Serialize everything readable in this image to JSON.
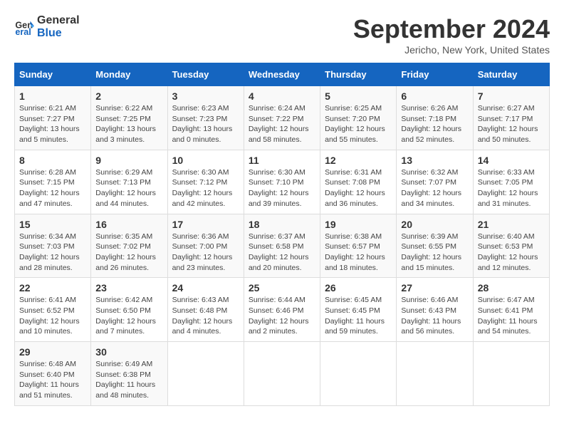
{
  "logo": {
    "line1": "General",
    "line2": "Blue"
  },
  "title": "September 2024",
  "location": "Jericho, New York, United States",
  "days_of_week": [
    "Sunday",
    "Monday",
    "Tuesday",
    "Wednesday",
    "Thursday",
    "Friday",
    "Saturday"
  ],
  "weeks": [
    [
      {
        "day": "1",
        "sunrise": "Sunrise: 6:21 AM",
        "sunset": "Sunset: 7:27 PM",
        "daylight": "Daylight: 13 hours and 5 minutes."
      },
      {
        "day": "2",
        "sunrise": "Sunrise: 6:22 AM",
        "sunset": "Sunset: 7:25 PM",
        "daylight": "Daylight: 13 hours and 3 minutes."
      },
      {
        "day": "3",
        "sunrise": "Sunrise: 6:23 AM",
        "sunset": "Sunset: 7:23 PM",
        "daylight": "Daylight: 13 hours and 0 minutes."
      },
      {
        "day": "4",
        "sunrise": "Sunrise: 6:24 AM",
        "sunset": "Sunset: 7:22 PM",
        "daylight": "Daylight: 12 hours and 58 minutes."
      },
      {
        "day": "5",
        "sunrise": "Sunrise: 6:25 AM",
        "sunset": "Sunset: 7:20 PM",
        "daylight": "Daylight: 12 hours and 55 minutes."
      },
      {
        "day": "6",
        "sunrise": "Sunrise: 6:26 AM",
        "sunset": "Sunset: 7:18 PM",
        "daylight": "Daylight: 12 hours and 52 minutes."
      },
      {
        "day": "7",
        "sunrise": "Sunrise: 6:27 AM",
        "sunset": "Sunset: 7:17 PM",
        "daylight": "Daylight: 12 hours and 50 minutes."
      }
    ],
    [
      {
        "day": "8",
        "sunrise": "Sunrise: 6:28 AM",
        "sunset": "Sunset: 7:15 PM",
        "daylight": "Daylight: 12 hours and 47 minutes."
      },
      {
        "day": "9",
        "sunrise": "Sunrise: 6:29 AM",
        "sunset": "Sunset: 7:13 PM",
        "daylight": "Daylight: 12 hours and 44 minutes."
      },
      {
        "day": "10",
        "sunrise": "Sunrise: 6:30 AM",
        "sunset": "Sunset: 7:12 PM",
        "daylight": "Daylight: 12 hours and 42 minutes."
      },
      {
        "day": "11",
        "sunrise": "Sunrise: 6:30 AM",
        "sunset": "Sunset: 7:10 PM",
        "daylight": "Daylight: 12 hours and 39 minutes."
      },
      {
        "day": "12",
        "sunrise": "Sunrise: 6:31 AM",
        "sunset": "Sunset: 7:08 PM",
        "daylight": "Daylight: 12 hours and 36 minutes."
      },
      {
        "day": "13",
        "sunrise": "Sunrise: 6:32 AM",
        "sunset": "Sunset: 7:07 PM",
        "daylight": "Daylight: 12 hours and 34 minutes."
      },
      {
        "day": "14",
        "sunrise": "Sunrise: 6:33 AM",
        "sunset": "Sunset: 7:05 PM",
        "daylight": "Daylight: 12 hours and 31 minutes."
      }
    ],
    [
      {
        "day": "15",
        "sunrise": "Sunrise: 6:34 AM",
        "sunset": "Sunset: 7:03 PM",
        "daylight": "Daylight: 12 hours and 28 minutes."
      },
      {
        "day": "16",
        "sunrise": "Sunrise: 6:35 AM",
        "sunset": "Sunset: 7:02 PM",
        "daylight": "Daylight: 12 hours and 26 minutes."
      },
      {
        "day": "17",
        "sunrise": "Sunrise: 6:36 AM",
        "sunset": "Sunset: 7:00 PM",
        "daylight": "Daylight: 12 hours and 23 minutes."
      },
      {
        "day": "18",
        "sunrise": "Sunrise: 6:37 AM",
        "sunset": "Sunset: 6:58 PM",
        "daylight": "Daylight: 12 hours and 20 minutes."
      },
      {
        "day": "19",
        "sunrise": "Sunrise: 6:38 AM",
        "sunset": "Sunset: 6:57 PM",
        "daylight": "Daylight: 12 hours and 18 minutes."
      },
      {
        "day": "20",
        "sunrise": "Sunrise: 6:39 AM",
        "sunset": "Sunset: 6:55 PM",
        "daylight": "Daylight: 12 hours and 15 minutes."
      },
      {
        "day": "21",
        "sunrise": "Sunrise: 6:40 AM",
        "sunset": "Sunset: 6:53 PM",
        "daylight": "Daylight: 12 hours and 12 minutes."
      }
    ],
    [
      {
        "day": "22",
        "sunrise": "Sunrise: 6:41 AM",
        "sunset": "Sunset: 6:52 PM",
        "daylight": "Daylight: 12 hours and 10 minutes."
      },
      {
        "day": "23",
        "sunrise": "Sunrise: 6:42 AM",
        "sunset": "Sunset: 6:50 PM",
        "daylight": "Daylight: 12 hours and 7 minutes."
      },
      {
        "day": "24",
        "sunrise": "Sunrise: 6:43 AM",
        "sunset": "Sunset: 6:48 PM",
        "daylight": "Daylight: 12 hours and 4 minutes."
      },
      {
        "day": "25",
        "sunrise": "Sunrise: 6:44 AM",
        "sunset": "Sunset: 6:46 PM",
        "daylight": "Daylight: 12 hours and 2 minutes."
      },
      {
        "day": "26",
        "sunrise": "Sunrise: 6:45 AM",
        "sunset": "Sunset: 6:45 PM",
        "daylight": "Daylight: 11 hours and 59 minutes."
      },
      {
        "day": "27",
        "sunrise": "Sunrise: 6:46 AM",
        "sunset": "Sunset: 6:43 PM",
        "daylight": "Daylight: 11 hours and 56 minutes."
      },
      {
        "day": "28",
        "sunrise": "Sunrise: 6:47 AM",
        "sunset": "Sunset: 6:41 PM",
        "daylight": "Daylight: 11 hours and 54 minutes."
      }
    ],
    [
      {
        "day": "29",
        "sunrise": "Sunrise: 6:48 AM",
        "sunset": "Sunset: 6:40 PM",
        "daylight": "Daylight: 11 hours and 51 minutes."
      },
      {
        "day": "30",
        "sunrise": "Sunrise: 6:49 AM",
        "sunset": "Sunset: 6:38 PM",
        "daylight": "Daylight: 11 hours and 48 minutes."
      },
      null,
      null,
      null,
      null,
      null
    ]
  ]
}
